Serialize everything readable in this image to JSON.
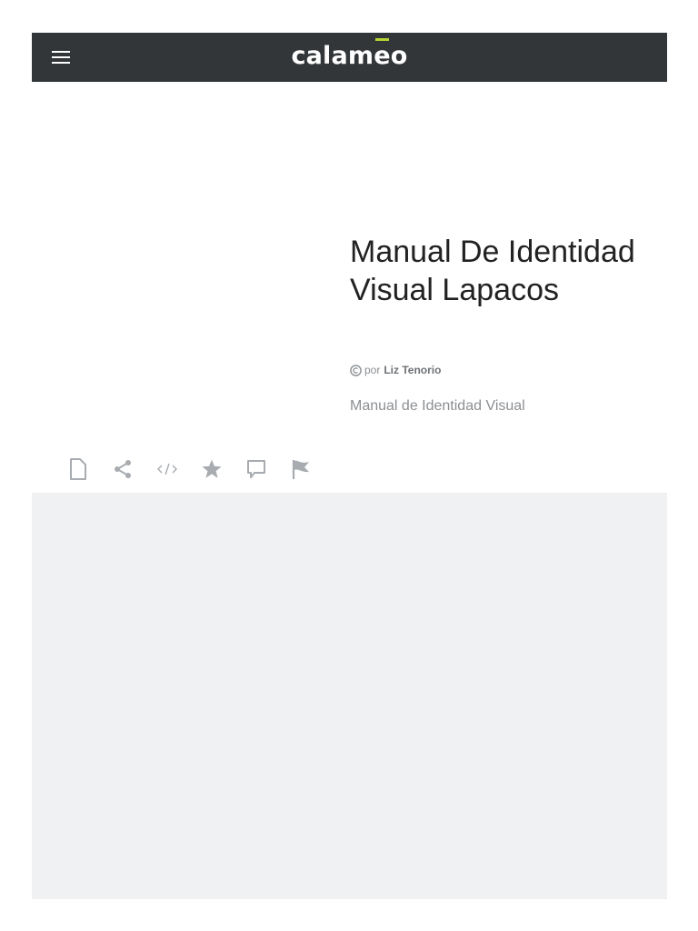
{
  "header": {
    "brand_main": "calam",
    "brand_e": "e",
    "brand_tail": "o",
    "background": "#323638",
    "accent": "#b5d334"
  },
  "document": {
    "title": "Manual De Identidad Visual Lapacos",
    "by_prefix": "por",
    "author": "Liz Tenorio",
    "description": "Manual de Identidad Visual"
  },
  "actions": [
    {
      "icon": "document-icon"
    },
    {
      "icon": "share-icon"
    },
    {
      "icon": "embed-icon"
    },
    {
      "icon": "star-icon"
    },
    {
      "icon": "comment-icon"
    },
    {
      "icon": "flag-icon"
    }
  ],
  "viewer": {
    "background": "#f0f1f3"
  }
}
